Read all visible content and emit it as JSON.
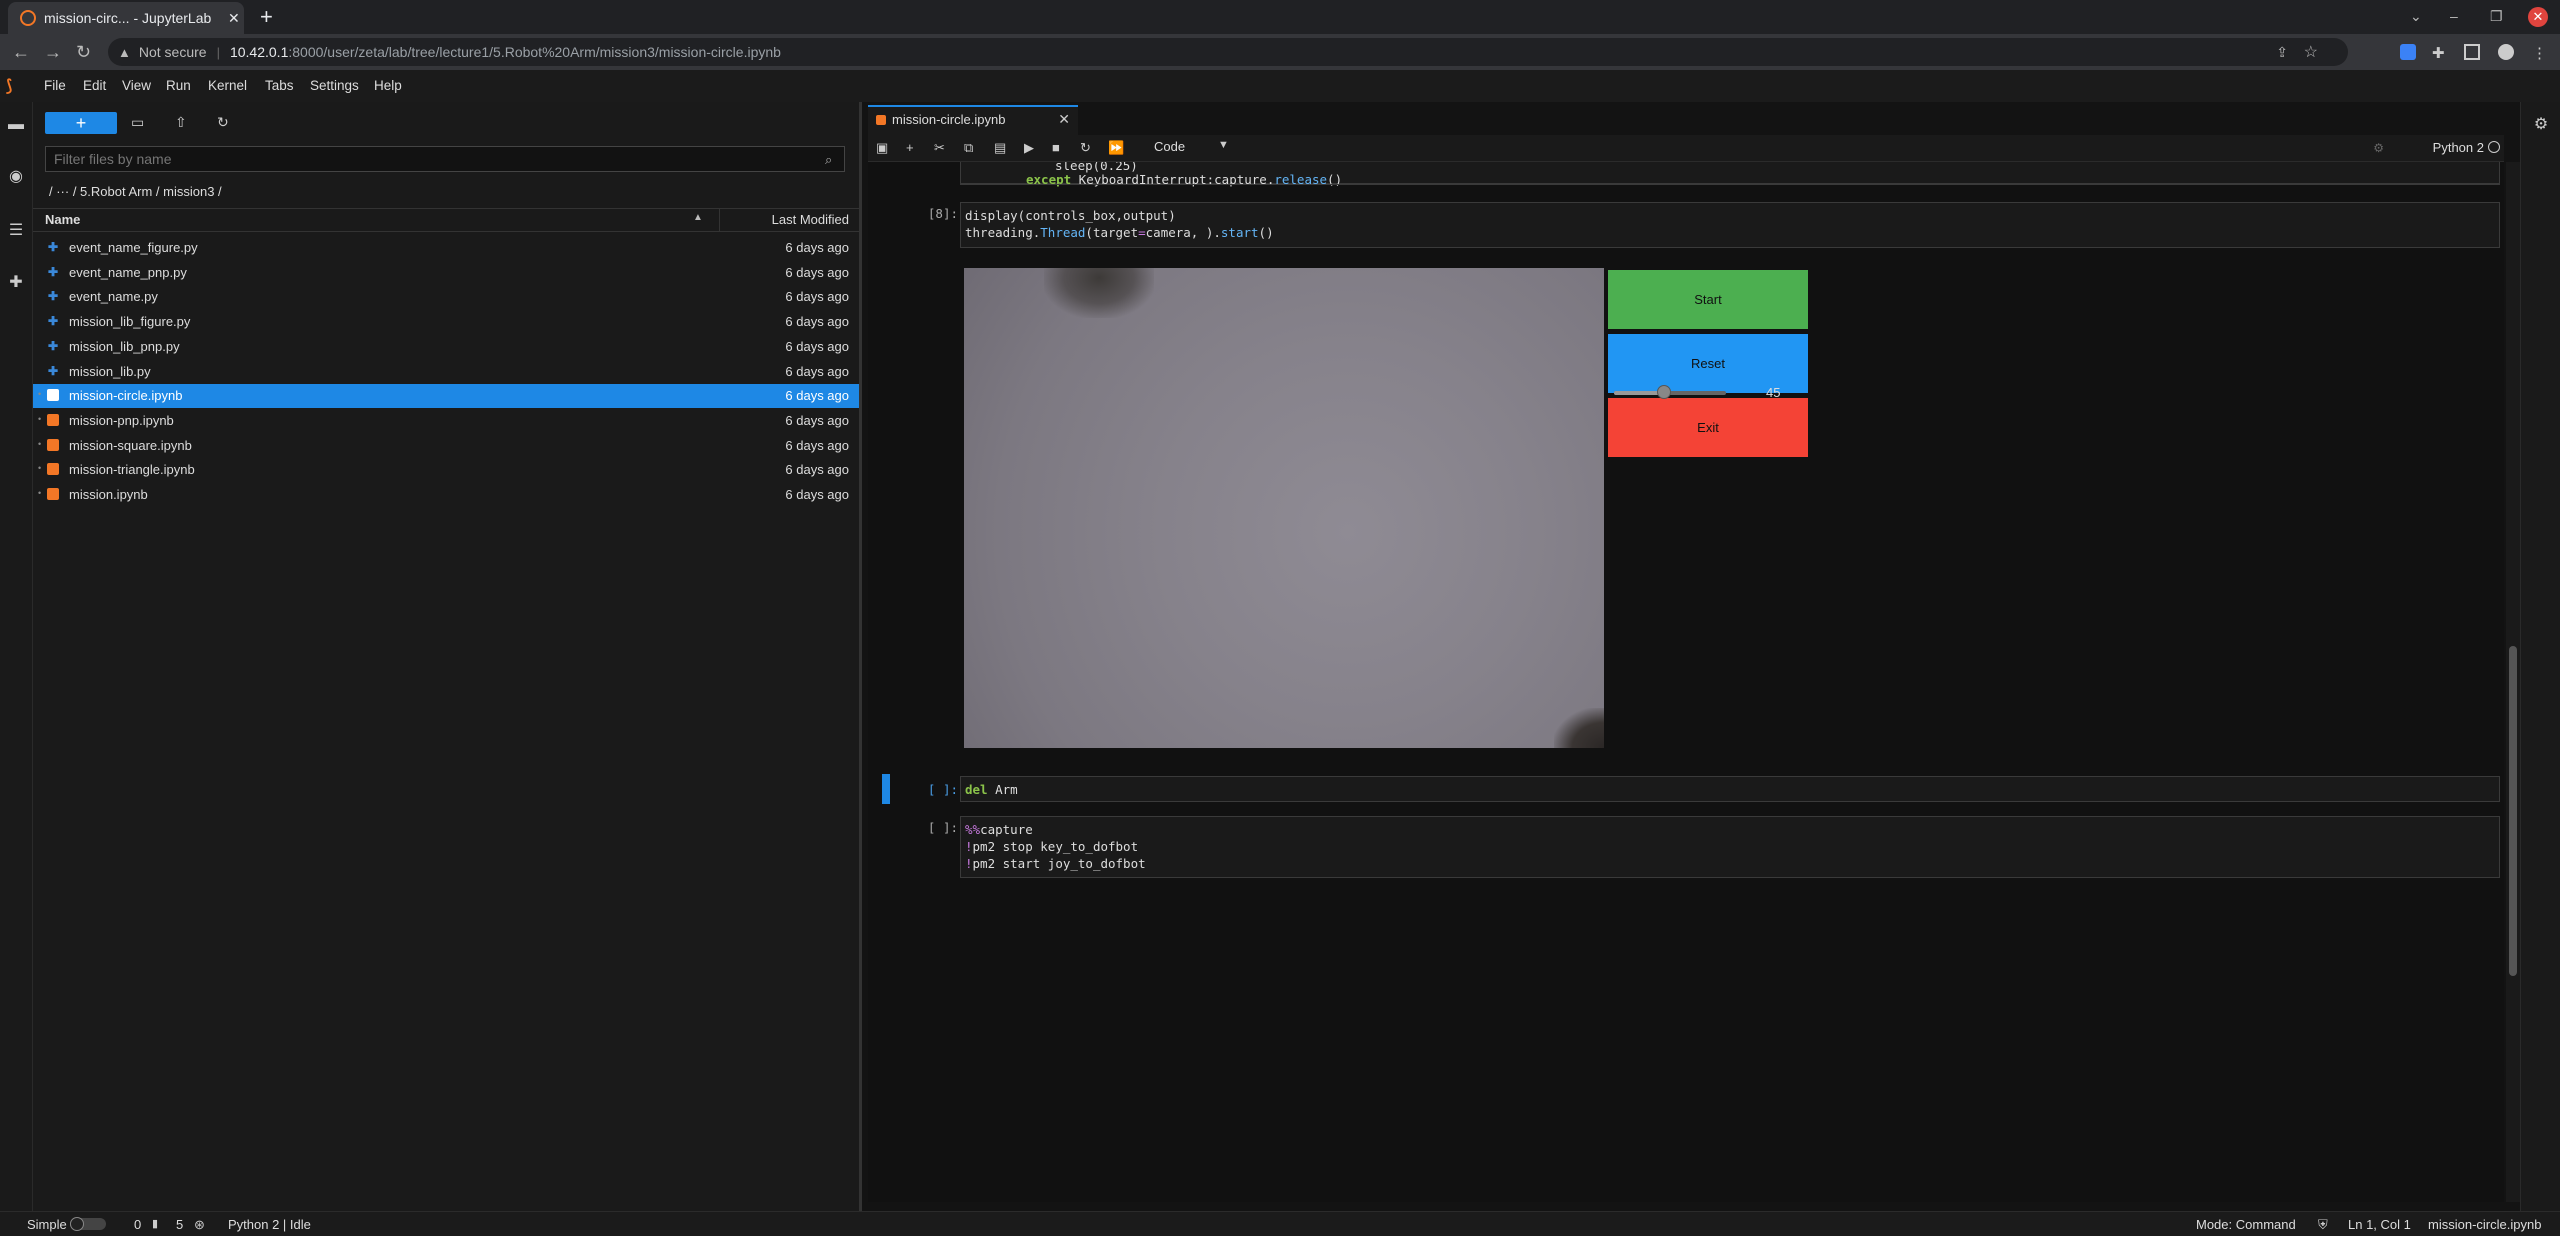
{
  "browser": {
    "tab_title": "mission-circ... - JupyterLab",
    "new_tab": "+",
    "close_tab": "✕",
    "not_secure": "Not secure",
    "url_host": "10.42.0.1",
    "url_path": ":8000/user/zeta/lab/tree/lecture1/5.Robot%20Arm/mission3/mission-circle.ipynb"
  },
  "menubar": {
    "items": [
      "File",
      "Edit",
      "View",
      "Run",
      "Kernel",
      "Tabs",
      "Settings",
      "Help"
    ]
  },
  "filebrowser": {
    "new_label": "+",
    "filter_placeholder": "Filter files by name",
    "breadcrumb": "/   ···   / 5.Robot Arm / mission3 /",
    "col_name": "Name",
    "col_modified": "Last Modified",
    "files": [
      {
        "name": "event_name_figure.py",
        "modified": "6 days ago",
        "type": "py",
        "selected": false
      },
      {
        "name": "event_name_pnp.py",
        "modified": "6 days ago",
        "type": "py",
        "selected": false
      },
      {
        "name": "event_name.py",
        "modified": "6 days ago",
        "type": "py",
        "selected": false
      },
      {
        "name": "mission_lib_figure.py",
        "modified": "6 days ago",
        "type": "py",
        "selected": false
      },
      {
        "name": "mission_lib_pnp.py",
        "modified": "6 days ago",
        "type": "py",
        "selected": false
      },
      {
        "name": "mission_lib.py",
        "modified": "6 days ago",
        "type": "py",
        "selected": false
      },
      {
        "name": "mission-circle.ipynb",
        "modified": "6 days ago",
        "type": "nb",
        "selected": true
      },
      {
        "name": "mission-pnp.ipynb",
        "modified": "6 days ago",
        "type": "nb",
        "selected": false
      },
      {
        "name": "mission-square.ipynb",
        "modified": "6 days ago",
        "type": "nb",
        "selected": false
      },
      {
        "name": "mission-triangle.ipynb",
        "modified": "6 days ago",
        "type": "nb",
        "selected": false
      },
      {
        "name": "mission.ipynb",
        "modified": "6 days ago",
        "type": "nb",
        "selected": false
      }
    ]
  },
  "notebook": {
    "tab_label": "mission-circle.ipynb",
    "cell_type": "Code",
    "kernel": "Python 2",
    "cell0": {
      "line1": "sleep(0.25)",
      "line2_kw": "except",
      "line2_rest": " KeyboardInterrupt:capture.",
      "line2_fn": "release",
      "line2_end": "()"
    },
    "cell1": {
      "prompt": "[8]:",
      "line1": "display(controls_box,output)",
      "line2_a": "threading.",
      "line2_b": "Thread",
      "line2_c": "(target",
      "line2_op": "=",
      "line2_d": "camera, ).",
      "line2_e": "start",
      "line2_f": "()"
    },
    "widgets": {
      "start": "Start",
      "reset": "Reset",
      "exit": "Exit",
      "slider_value": "45",
      "slider_fraction": 0.45
    },
    "cell2": {
      "prompt": "[ ]:",
      "kw": "del",
      "rest": " Arm"
    },
    "cell3": {
      "prompt": "[ ]:",
      "line1_mg": "%%",
      "line1": "capture",
      "line2_bang": "!",
      "line2": "pm2 stop key_to_dofbot",
      "line3_bang": "!",
      "line3": "pm2 start joy_to_dofbot"
    }
  },
  "status": {
    "mode_label": "Simple",
    "num1": "0",
    "num2": "5",
    "kernel_status": "Python 2 | Idle",
    "mode": "Mode: Command",
    "cursor": "Ln 1, Col 1",
    "filename": "mission-circle.ipynb"
  },
  "colors": {
    "accent": "#1e88e5",
    "start": "#4caf50",
    "reset": "#2196f3",
    "exit": "#f44336",
    "jupyter": "#f37726"
  }
}
